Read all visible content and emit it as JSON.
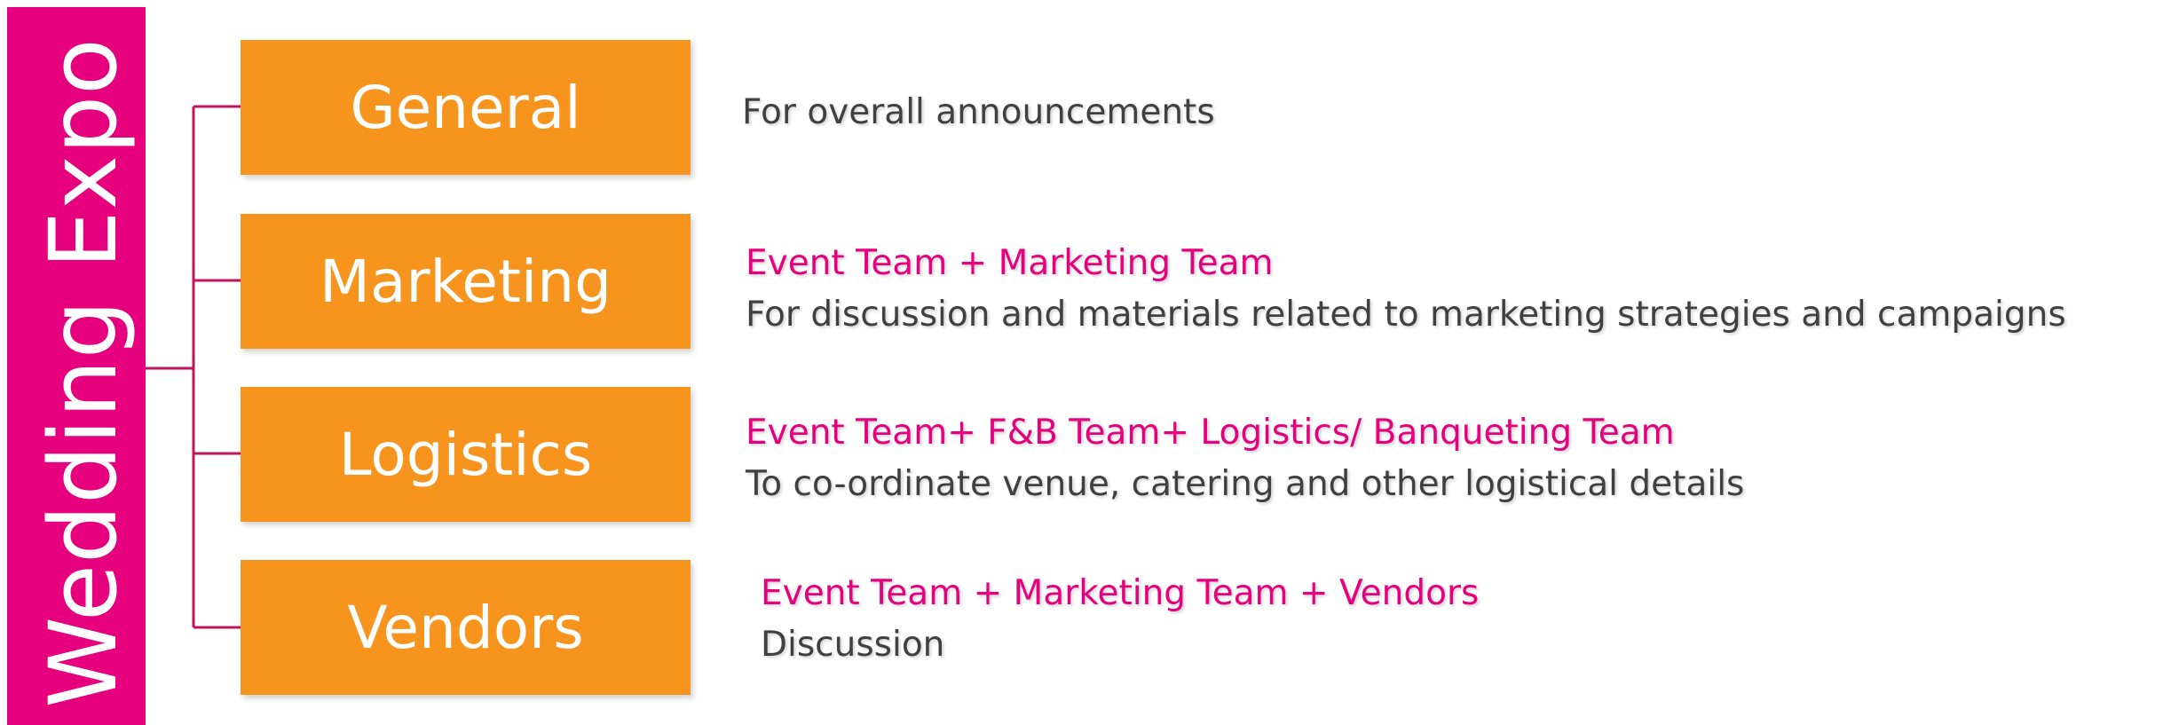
{
  "root": {
    "label": "Wedding Expo"
  },
  "branches": [
    {
      "label": "General",
      "team": "",
      "description": "For overall announcements"
    },
    {
      "label": "Marketing",
      "team": "Event Team + Marketing Team",
      "description": "For discussion and materials related to marketing strategies and campaigns"
    },
    {
      "label": "Logistics",
      "team": "Event Team+ F&B Team+ Logistics/ Banqueting Team",
      "description": "To co-ordinate venue, catering and other logistical details"
    },
    {
      "label": "Vendors",
      "team": "Event Team + Marketing Team + Vendors",
      "description": "Discussion"
    }
  ],
  "colors": {
    "root": "#e6007e",
    "box": "#f7941d",
    "connector": "#c0145f",
    "team_text": "#e6007e",
    "description_text": "#404040"
  }
}
